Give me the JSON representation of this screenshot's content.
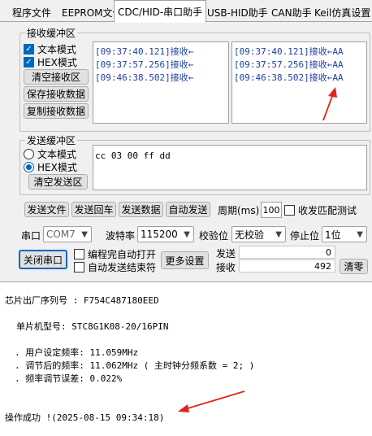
{
  "tabs": [
    "程序文件",
    "EEPROM文件",
    "CDC/HID-串口助手",
    "USB-HID助手",
    "CAN助手",
    "Keil仿真设置"
  ],
  "active_tab": "CDC/HID-串口助手",
  "receive": {
    "title": "接收缓冲区",
    "text_mode": "文本模式",
    "hex_mode": "HEX模式",
    "clear_btn": "清空接收区",
    "save_btn": "保存接收数据",
    "copy_btn": "复制接收数据",
    "left_lines": [
      "[09:37:40.121]接收←",
      "[09:37:57.256]接收←",
      "[09:46:38.502]接收←"
    ],
    "right_lines": [
      "[09:37:40.121]接收←AA",
      "[09:37:57.256]接收←AA",
      "[09:46:38.502]接收←AA"
    ]
  },
  "send": {
    "title": "发送缓冲区",
    "text_mode": "文本模式",
    "hex_mode": "HEX模式",
    "clear_btn": "清空发送区",
    "content": "cc 03 00 ff dd"
  },
  "toolbar": {
    "send_file": "发送文件",
    "send_enter": "发送回车",
    "send_data": "发送数据",
    "auto_send": "自动发送",
    "period_label": "周期(ms)",
    "period_value": "100",
    "match_check": "收发匹配测试"
  },
  "serial": {
    "port_label": "串口",
    "port_value": "COM7",
    "baud_label": "波特率",
    "baud_value": "115200",
    "parity_label": "校验位",
    "parity_value": "无校验",
    "stop_label": "停止位",
    "stop_value": "1位",
    "close_btn": "关闭串口",
    "auto_open": "编程完自动打开",
    "auto_stop": "自动发送结束符",
    "more_btn": "更多设置",
    "send_label": "发送",
    "send_count": "0",
    "recv_label": "接收",
    "recv_count": "492",
    "clear_btn": "清零"
  },
  "output": {
    "lines": [
      "芯片出厂序列号 : F754C487180EED",
      "单片机型号: STC8G1K08-20/16PIN",
      ". 用户设定频率: 11.059MHz",
      ". 调节后的频率: 11.062MHz ( 主时钟分频系数 = 2; )",
      ". 频率调节误差: 0.022%",
      "操作成功 !(2025-08-15 09:34:18)"
    ]
  },
  "colors": {
    "accent": "#0067c0",
    "received_text": "#1f3f9f",
    "annotation_arrow": "#e0241b"
  }
}
